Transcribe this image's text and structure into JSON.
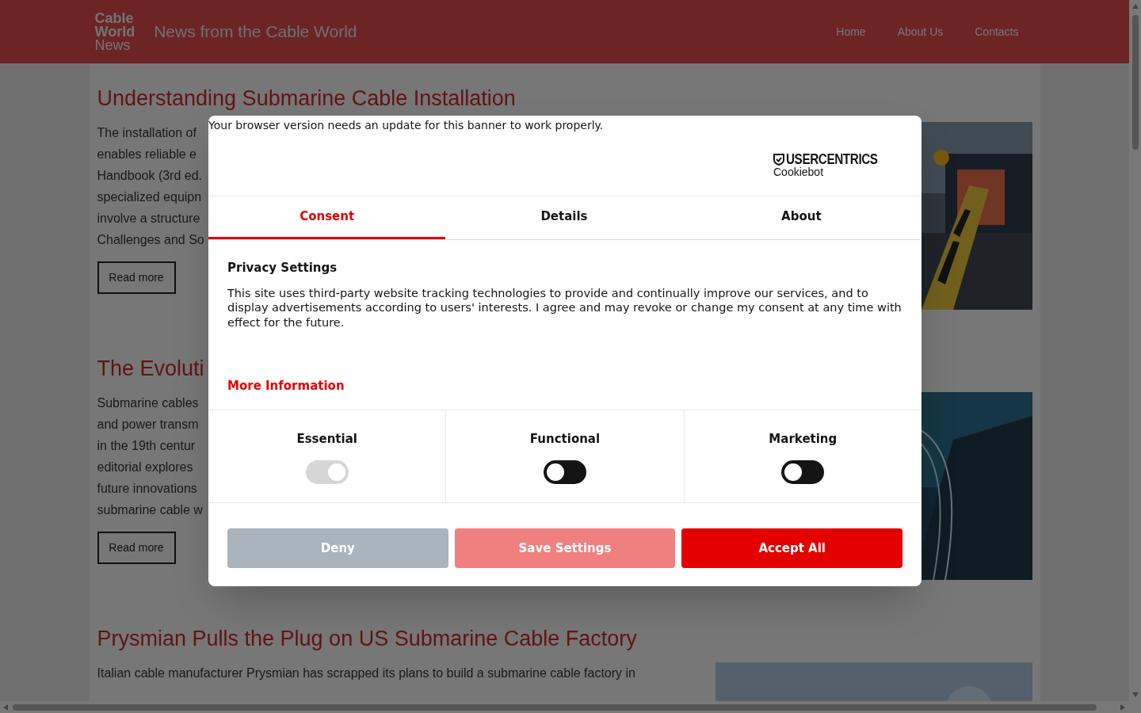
{
  "header": {
    "logo": [
      "Cable",
      "World",
      "News"
    ],
    "tagline": "News from the Cable World",
    "nav": [
      {
        "label": "Home"
      },
      {
        "label": "About Us"
      },
      {
        "label": "Contacts"
      }
    ]
  },
  "articles": [
    {
      "title": "Understanding Submarine Cable Installation",
      "lines": [
        "The installation of",
        "enables reliable e",
        "Handbook (3rd ed.",
        "specialized equipn",
        "involve a structure",
        "Challenges and So"
      ],
      "button": "Read more"
    },
    {
      "title": "The Evoluti",
      "lines": [
        "Submarine cables",
        "and power transm",
        "in the 19th centur",
        "editorial explores",
        "future innovations",
        "submarine cable w"
      ],
      "button": "Read more"
    },
    {
      "title": "Prysmian Pulls the Plug on US Submarine Cable Factory",
      "lines": [
        "Italian cable manufacturer Prysmian has scrapped its plans to build a submarine cable factory in"
      ]
    }
  ],
  "consent": {
    "notice": "Your browser version needs an update for this banner to work properly.",
    "brand": "USERCENTRICS",
    "product": "Cookiebot",
    "tabs": [
      {
        "label": "Consent",
        "selected": true
      },
      {
        "label": "Details",
        "selected": false
      },
      {
        "label": "About",
        "selected": false
      }
    ],
    "heading": "Privacy Settings",
    "text": "This site uses third-party website tracking technologies to provide and continually improve our services, and to display advertisements according to users' interests. I agree and may revoke or change my consent at any time with effect for the future.",
    "link": "More Information",
    "categories": [
      {
        "label": "Essential",
        "checked": true,
        "disabled": true
      },
      {
        "label": "Functional",
        "checked": false,
        "disabled": false
      },
      {
        "label": "Marketing",
        "checked": false,
        "disabled": false
      }
    ],
    "buttons": [
      {
        "label": "Deny",
        "kind": "muted"
      },
      {
        "label": "Save Settings",
        "kind": "soft"
      },
      {
        "label": "Accept All",
        "kind": "primary"
      }
    ]
  }
}
